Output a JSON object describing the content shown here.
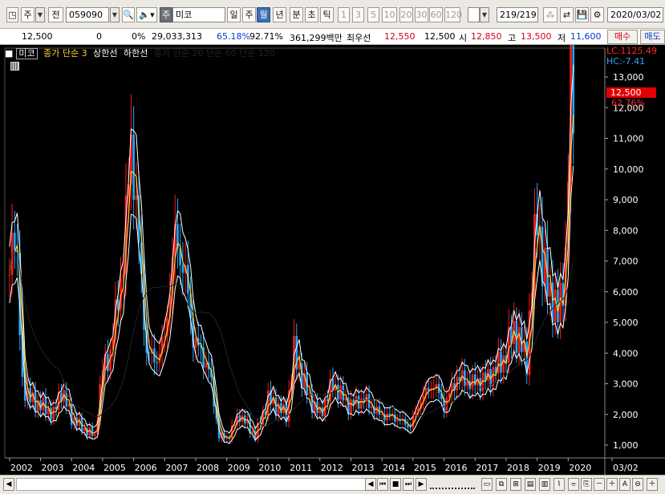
{
  "toolbar": {
    "period_type": "주",
    "prev_label": "전",
    "stock_code": "059090",
    "stock_badge": "주",
    "stock_name": "미코",
    "tabs": [
      "일",
      "주",
      "월",
      "년",
      "분",
      "초",
      "틱"
    ],
    "active_tab": "월",
    "intervals": [
      "1",
      "3",
      "5",
      "10",
      "20",
      "30",
      "60",
      "120"
    ],
    "count": "219/219",
    "date": "2020/03/02"
  },
  "quote": {
    "price": "12,500",
    "change": "0",
    "change_rate": "0%",
    "volume": "29,033,313",
    "ratio1": "65.18%",
    "ratio2": "92.71%",
    "amount": "361,299백만",
    "priority_label": "최우선",
    "priority_ask": "12,550",
    "priority_bid": "12,500",
    "open_label": "시",
    "open": "12,850",
    "high_label": "고",
    "high": "13,500",
    "low_label": "저",
    "low": "11,600",
    "buy_button": "매수",
    "sell_button": "매도"
  },
  "legend": {
    "name": "미코",
    "indicator": "종가 단순 3",
    "upper": "상한선",
    "lower": "하한선",
    "extra": "종가 단순 20 단순 60 단순 120"
  },
  "right_labels": {
    "lc": "LC:1125.49",
    "hc": "HC:-7.41",
    "last_price": "12,500",
    "last_pct": "62.76%"
  },
  "colors": {
    "up": "#ff1a1a",
    "down": "#23a8ff",
    "ma": "#ffd23a",
    "band": "#ffffff",
    "axis_text": "#ffffff",
    "price_box": "#e00000"
  },
  "chart_data": {
    "type": "candlestick",
    "frequency": "monthly",
    "x_tick_labels": [
      "2002",
      "2003",
      "2004",
      "2005",
      "2006",
      "2007",
      "2008",
      "2009",
      "2010",
      "2011",
      "2012",
      "2013",
      "2014",
      "2015",
      "2016",
      "2017",
      "2018",
      "2019",
      "2020",
      "03/02"
    ],
    "y_tick_labels": [
      "1,000",
      "2,000",
      "3,000",
      "4,000",
      "5,000",
      "6,000",
      "7,000",
      "8,000",
      "9,000",
      "10,000",
      "11,000",
      "12,000",
      "13,000"
    ],
    "ylim": [
      600,
      13900
    ],
    "close_series": [
      {
        "date": "2002-01",
        "value": 7000
      },
      {
        "date": "2002-03",
        "value": 8300
      },
      {
        "date": "2002-06",
        "value": 3000
      },
      {
        "date": "2002-09",
        "value": 2500
      },
      {
        "date": "2003-01",
        "value": 2300
      },
      {
        "date": "2003-06",
        "value": 2000
      },
      {
        "date": "2003-09",
        "value": 2800
      },
      {
        "date": "2004-01",
        "value": 1900
      },
      {
        "date": "2004-06",
        "value": 1500
      },
      {
        "date": "2004-10",
        "value": 1300
      },
      {
        "date": "2005-01",
        "value": 3500
      },
      {
        "date": "2005-04",
        "value": 4000
      },
      {
        "date": "2005-09",
        "value": 7000
      },
      {
        "date": "2005-12",
        "value": 11000
      },
      {
        "date": "2006-03",
        "value": 7500
      },
      {
        "date": "2006-06",
        "value": 4000
      },
      {
        "date": "2006-10",
        "value": 3800
      },
      {
        "date": "2007-01",
        "value": 4500
      },
      {
        "date": "2007-05",
        "value": 7800
      },
      {
        "date": "2007-09",
        "value": 6500
      },
      {
        "date": "2007-12",
        "value": 4500
      },
      {
        "date": "2008-06",
        "value": 3500
      },
      {
        "date": "2008-10",
        "value": 1300
      },
      {
        "date": "2009-01",
        "value": 1200
      },
      {
        "date": "2009-06",
        "value": 2000
      },
      {
        "date": "2009-12",
        "value": 1300
      },
      {
        "date": "2010-05",
        "value": 2500
      },
      {
        "date": "2010-12",
        "value": 2000
      },
      {
        "date": "2011-03",
        "value": 4000
      },
      {
        "date": "2011-09",
        "value": 2500
      },
      {
        "date": "2012-01",
        "value": 2000
      },
      {
        "date": "2012-06",
        "value": 3000
      },
      {
        "date": "2012-12",
        "value": 2300
      },
      {
        "date": "2013-06",
        "value": 2500
      },
      {
        "date": "2013-12",
        "value": 2000
      },
      {
        "date": "2014-06",
        "value": 1900
      },
      {
        "date": "2014-12",
        "value": 1600
      },
      {
        "date": "2015-04",
        "value": 2500
      },
      {
        "date": "2015-09",
        "value": 3000
      },
      {
        "date": "2016-01",
        "value": 2300
      },
      {
        "date": "2016-06",
        "value": 3200
      },
      {
        "date": "2016-12",
        "value": 3000
      },
      {
        "date": "2017-06",
        "value": 3200
      },
      {
        "date": "2017-12",
        "value": 3800
      },
      {
        "date": "2018-04",
        "value": 4800
      },
      {
        "date": "2018-09",
        "value": 3800
      },
      {
        "date": "2019-01",
        "value": 8800
      },
      {
        "date": "2019-03",
        "value": 6800
      },
      {
        "date": "2019-06",
        "value": 6000
      },
      {
        "date": "2019-09",
        "value": 5200
      },
      {
        "date": "2019-12",
        "value": 7000
      },
      {
        "date": "2020-02",
        "value": 13000
      },
      {
        "date": "2020-03",
        "value": 12500
      }
    ]
  },
  "bottom": {
    "controls": [
      "◀",
      "⏮",
      "■",
      "⏭",
      "▶"
    ],
    "zoom": [
      "－",
      "＋",
      "A",
      "⊖",
      "＋"
    ]
  }
}
